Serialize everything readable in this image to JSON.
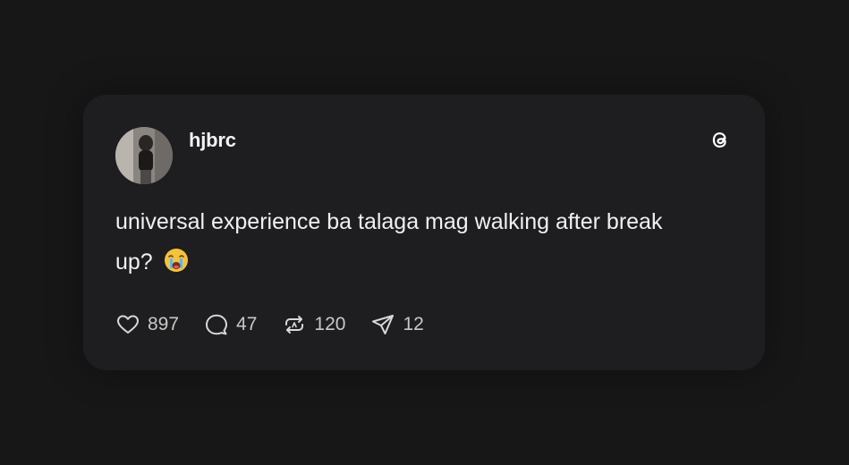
{
  "post": {
    "username": "hjbrc",
    "text": "universal experience ba talaga mag walking after break up?",
    "emoji": "crying-face-emoji"
  },
  "actions": {
    "likes": "897",
    "replies": "47",
    "reposts": "120",
    "shares": "12"
  },
  "colors": {
    "background": "#171718",
    "card": "#1e1e20",
    "text": "#f0f0f0",
    "muted": "#c8c8c8"
  }
}
